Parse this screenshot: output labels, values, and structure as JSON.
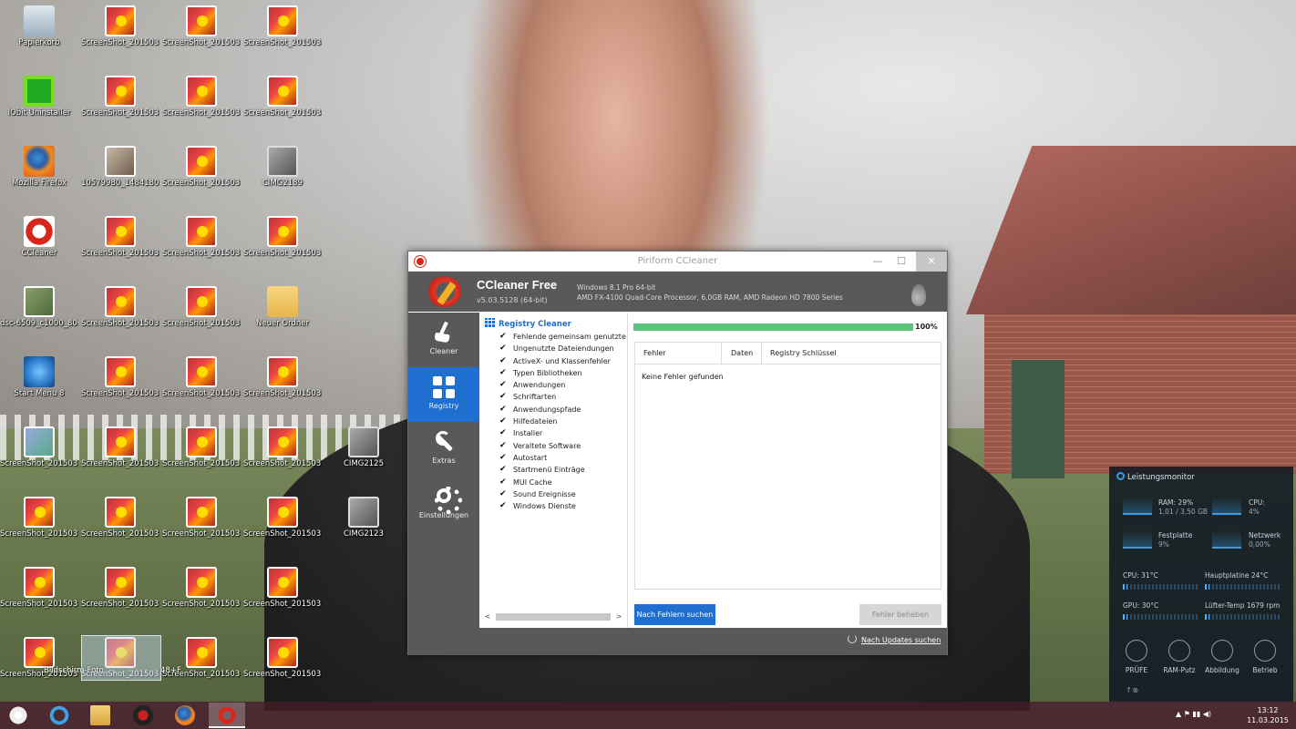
{
  "desktop": {
    "icons": [
      {
        "label": "Papierkorb",
        "type": "bin"
      },
      {
        "label": "ScreenShot_201503...",
        "type": "shot"
      },
      {
        "label": "ScreenShot_201503...",
        "type": "shot"
      },
      {
        "label": "ScreenShot_201503...",
        "type": "shot"
      },
      {
        "label": "IObit Uninstaller",
        "type": "iobit"
      },
      {
        "label": "ScreenShot_201503...",
        "type": "shot"
      },
      {
        "label": "ScreenShot_201503...",
        "type": "shot"
      },
      {
        "label": "ScreenShot_201503...",
        "type": "shot"
      },
      {
        "label": "Mozilla Firefox",
        "type": "firefox"
      },
      {
        "label": "10579980_1484180...",
        "type": "photo"
      },
      {
        "label": "ScreenShot_201503...",
        "type": "shot"
      },
      {
        "label": "CIMG2189",
        "type": "gray"
      },
      {
        "label": "CCleaner",
        "type": "ccleaner"
      },
      {
        "label": "ScreenShot_201503...",
        "type": "shot"
      },
      {
        "label": "ScreenShot_201503...",
        "type": "shot"
      },
      {
        "label": "ScreenShot_201503...",
        "type": "shot"
      },
      {
        "label": "dsc-6509_c1000_800",
        "type": "dsc"
      },
      {
        "label": "ScreenShot_201503...",
        "type": "shot"
      },
      {
        "label": "ScreenShot_201503...",
        "type": "shot"
      },
      {
        "label": "Neuer Ordner",
        "type": "folder"
      },
      {
        "label": "Start Menu 8",
        "type": "win"
      },
      {
        "label": "ScreenShot_201503...",
        "type": "shot"
      },
      {
        "label": "ScreenShot_201503...",
        "type": "shot"
      },
      {
        "label": "ScreenShot_201503...",
        "type": "shot"
      },
      {
        "label": "ScreenShot_201503...",
        "type": "shot2"
      },
      {
        "label": "ScreenShot_201503...",
        "type": "shot"
      },
      {
        "label": "ScreenShot_201503...",
        "type": "shot"
      },
      {
        "label": "ScreenShot_201503...",
        "type": "shot"
      },
      {
        "label": "CIMG2125",
        "type": "gray"
      },
      {
        "label": "ScreenShot_201503...",
        "type": "shot"
      },
      {
        "label": "ScreenShot_201503...",
        "type": "shot"
      },
      {
        "label": "ScreenShot_201503...",
        "type": "shot"
      },
      {
        "label": "ScreenShot_201503...",
        "type": "shot"
      },
      {
        "label": "CIMG2123",
        "type": "gray"
      },
      {
        "label": "ScreenShot_201503...",
        "type": "shot"
      },
      {
        "label": "ScreenShot_201503...",
        "type": "shot"
      },
      {
        "label": "ScreenShot_201503...",
        "type": "shot"
      },
      {
        "label": "ScreenShot_201503...",
        "type": "shot"
      },
      {
        "label": "ScreenShot_201503...",
        "type": "shot"
      },
      {
        "label": "ScreenShot_201503...",
        "type": "shot"
      },
      {
        "label": "ScreenShot_201503...",
        "type": "shot"
      },
      {
        "label": "ScreenShot_201503...",
        "type": "shot"
      }
    ],
    "ghost_labels": [
      "Bildschirm-Foto",
      "48+F"
    ]
  },
  "ccleaner": {
    "window_title": "Piriform CCleaner",
    "title_buttons": {
      "minimize": "—",
      "maximize": "☐",
      "close": "✕"
    },
    "product_name": "CCleaner Free",
    "version": "v5.03.5128 (64-bit)",
    "sys_line1": "Windows 8.1 Pro 64-bit",
    "sys_line2": "AMD FX-4100 Quad-Core Processor, 6,0GB RAM, AMD Radeon HD 7800 Series",
    "nav": [
      {
        "label": "Cleaner",
        "icon": "broom-icon"
      },
      {
        "label": "Registry",
        "icon": "grid-icon",
        "active": true
      },
      {
        "label": "Extras",
        "icon": "wrench-icon"
      },
      {
        "label": "Einstellungen",
        "icon": "gear-icon"
      }
    ],
    "tree_heading": "Registry Cleaner",
    "tree_items": [
      "Fehlende gemeinsam genutzte DLLs",
      "Ungenutzte Dateiendungen",
      "ActiveX- und Klassenfehler",
      "Typen Bibliotheken",
      "Anwendungen",
      "Schriftarten",
      "Anwendungspfade",
      "Hilfedateien",
      "Installer",
      "Veraltete Software",
      "Autostart",
      "Startmenü Einträge",
      "MUI Cache",
      "Sound Ereignisse",
      "Windows Dienste"
    ],
    "check_mark": "✔",
    "progress_fraction": 1.0,
    "progress_label": "100%",
    "columns": [
      "Fehler",
      "Daten",
      "Registry Schlüssel"
    ],
    "result_message": "Keine Fehler gefunden",
    "scan_button": "Nach Fehlern suchen",
    "fix_button": "Fehler beheben",
    "update_link": "Nach Updates suchen",
    "colors": {
      "accent": "#1e6fd0",
      "progress": "#5cc37c",
      "sidebar": "#595959"
    }
  },
  "perf_monitor": {
    "title": "Leistungsmonitor",
    "ram_label": "RAM: 29%",
    "ram_sub": "1,01 / 3,50 GB",
    "cpu_label": "CPU:",
    "cpu_value": "4%",
    "disk_label": "Festplatte",
    "disk_value": "9%",
    "net_label": "Netzwerk",
    "net_value": "0,00%",
    "cpu_temp": "CPU:  31°C",
    "board_temp": "Hauptplatine  24°C",
    "gpu_temp": "GPU:  30°C",
    "fan": "Lüfter-Temp  1679 rpm",
    "bars": [
      0.06,
      0.06,
      0.06,
      0.06
    ],
    "buttons": [
      "PRÜFE",
      "RAM-Putz",
      "Abbildung",
      "Betrieb"
    ],
    "social": "f   ⊗"
  },
  "taskbar": {
    "apps": [
      "start-icon",
      "ie-icon",
      "explorer-icon",
      "sysinfo-icon",
      "firefox-icon",
      "ccleaner-icon"
    ],
    "tray_icons": "▲  ⚑  ▮▮  ◀)",
    "time": "13:12",
    "date": "11.03.2015"
  }
}
